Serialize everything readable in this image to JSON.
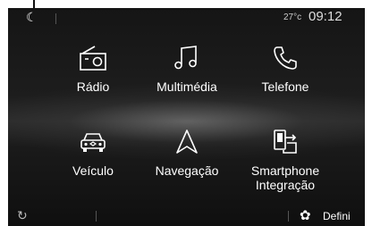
{
  "status": {
    "temperature": "27°c",
    "time": "09:12"
  },
  "menu": [
    {
      "label": "Rádio",
      "icon": "radio-icon"
    },
    {
      "label": "Multimédia",
      "icon": "music-note-icon"
    },
    {
      "label": "Telefone",
      "icon": "phone-icon"
    },
    {
      "label": "Veículo",
      "icon": "car-icon"
    },
    {
      "label": "Navegação",
      "icon": "navigation-arrow-icon"
    },
    {
      "label": "Smartphone Integração",
      "icon": "smartphone-icon"
    }
  ],
  "bottom": {
    "settings_label": "Defini"
  }
}
